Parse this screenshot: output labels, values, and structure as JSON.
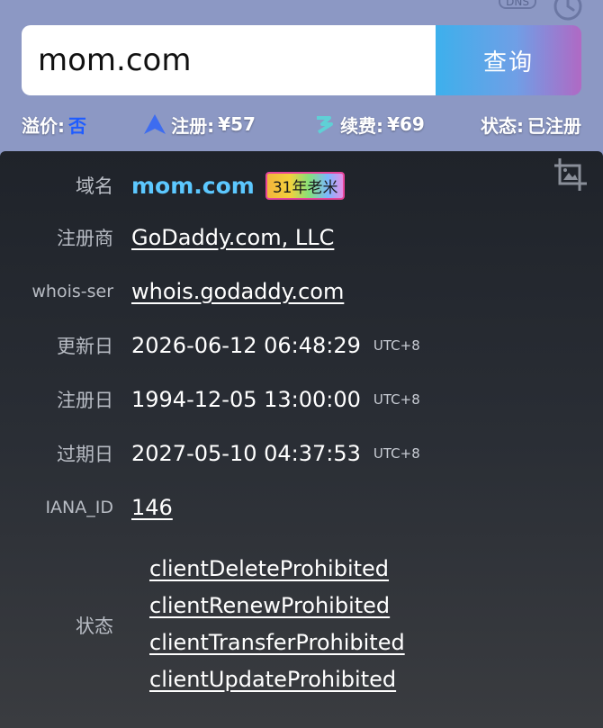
{
  "header": {
    "dns_label": "DNS",
    "dns_icon": "dns-icon",
    "history_icon": "history-icon"
  },
  "search": {
    "value": "mom.com",
    "button_label": "查询"
  },
  "summary": {
    "premium_label": "溢价:",
    "premium_value": "否",
    "register_label": "注册:",
    "register_price": "¥57",
    "renew_label": "续费:",
    "renew_price": "¥69",
    "status_label": "状态:",
    "status_value": "已注册",
    "colors": {
      "premium_value": "#1f5cff",
      "domain": "#5cc8ff"
    }
  },
  "details": {
    "domain_label": "域名",
    "domain_value": "mom.com",
    "age_badge": "31年老米",
    "registrar_label": "注册商",
    "registrar_value": "GoDaddy.com, LLC",
    "whois_label": "whois-ser",
    "whois_value": "whois.godaddy.com",
    "updated_label": "更新日",
    "updated_value": "2026-06-12 06:48:29",
    "registered_label": "注册日",
    "registered_value": "1994-12-05 13:00:00",
    "expires_label": "过期日",
    "expires_value": "2027-05-10 04:37:53",
    "timezone": "UTC+8",
    "iana_label": "IANA_ID",
    "iana_value": "146",
    "status_label": "状态",
    "statuses": [
      "clientDeleteProhibited",
      "clientRenewProhibited",
      "clientTransferProhibited",
      "clientUpdateProhibited"
    ]
  }
}
